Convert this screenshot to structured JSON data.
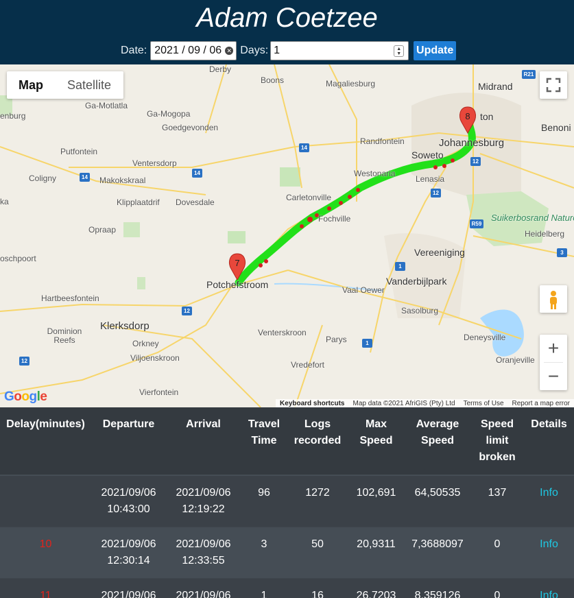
{
  "header": {
    "title": "Adam Coetzee",
    "date_label": "Date:",
    "date_value": "2021 / 09 / 06",
    "days_label": "Days:",
    "days_value": "1",
    "update_label": "Update"
  },
  "map": {
    "type_controls": {
      "map": "Map",
      "satellite": "Satellite"
    },
    "markers": [
      "7",
      "8"
    ],
    "attribution": {
      "logo": "Google",
      "shortcuts": "Keyboard shortcuts",
      "data": "Map data ©2021 AfriGIS (Pty) Ltd",
      "terms": "Terms of Use",
      "report": "Report a map error"
    },
    "places": [
      "Derby",
      "Boons",
      "Magaliesburg",
      "Midrand",
      "Ga-Motlatla",
      "Ga-Mogopa",
      "Goedgevonden",
      "Randfontein",
      "Johannesburg",
      "Benoni",
      "Putfontein",
      "Ventersdorp",
      "Soweto",
      "Westonaria",
      "Lenasia",
      "Coligny",
      "Makokskraal",
      "Carletonville",
      "Klipplaatdrif",
      "Dovesdale",
      "Fochville",
      "Opraap",
      "Suikerbosrand Nature Reserve",
      "Vereeniging",
      "Potchefstroom",
      "Vanderbijlpark",
      "Hartbeesfontein",
      "Vaal Oewer",
      "Sasolburg",
      "Klerksdorp",
      "Dominion Reefs",
      "Orkney",
      "Venterskroon",
      "Parys",
      "Deneysville",
      "Viljoenskroon",
      "Vredefort",
      "Oranjeville",
      "Vierfontein",
      "enburg",
      "ka",
      "oschpoort",
      "ton",
      "Heidelberg"
    ],
    "road_shields": [
      "R21",
      "14",
      "14",
      "14",
      "12",
      "12",
      "R59",
      "12",
      "1",
      "1",
      "12",
      "3",
      "12",
      "1"
    ]
  },
  "table": {
    "headers": [
      "Delay(minutes)",
      "Departure",
      "Arrival",
      "Travel Time",
      "Logs recorded",
      "Max Speed",
      "Average Speed",
      "Speed limit broken",
      "Details"
    ],
    "rows": [
      {
        "delay": "",
        "departure_date": "2021/09/06",
        "departure_time": "10:43:00",
        "arrival_date": "2021/09/06",
        "arrival_time": "12:19:22",
        "travel": "96",
        "logs": "1272",
        "max": "102,691",
        "avg": "64,50535",
        "broken": "137",
        "details": "Info"
      },
      {
        "delay": "10",
        "departure_date": "2021/09/06",
        "departure_time": "12:30:14",
        "arrival_date": "2021/09/06",
        "arrival_time": "12:33:55",
        "travel": "3",
        "logs": "50",
        "max": "20,9311",
        "avg": "7,3688097",
        "broken": "0",
        "details": "Info"
      },
      {
        "delay": "11",
        "departure_date": "2021/09/06",
        "departure_time": "",
        "arrival_date": "2021/09/06",
        "arrival_time": "",
        "travel": "1",
        "logs": "16",
        "max": "26,7203",
        "avg": "8,359126",
        "broken": "0",
        "details": "Info"
      }
    ]
  },
  "colors": {
    "header_bg": "#062f4a",
    "route": "#22e01a",
    "speeding": "#d32020",
    "info_link": "#1ec8e3",
    "delay": "#e3221b"
  }
}
